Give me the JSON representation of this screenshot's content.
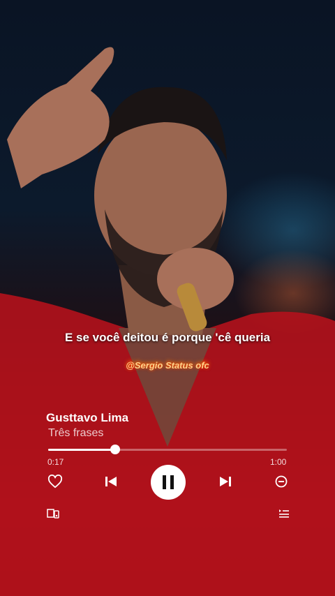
{
  "overlay": {
    "lyric": "E se você deitou é porque 'cê queria",
    "watermark": "@Sergio Status ofc"
  },
  "player": {
    "artist": "Gusttavo Lima",
    "song_title": "Três frases",
    "time_current": "0:17",
    "time_total": "1:00",
    "progress": 0.28,
    "state": "playing"
  },
  "icons": {
    "like": "heart-outline-icon",
    "previous": "skip-previous-icon",
    "play_pause": "pause-icon",
    "next": "skip-next-icon",
    "remove": "minus-circle-icon",
    "devices": "connect-devices-icon",
    "queue": "queue-icon"
  },
  "colors": {
    "accent": "#ffffff",
    "background_bottom": "#8e0e16"
  }
}
